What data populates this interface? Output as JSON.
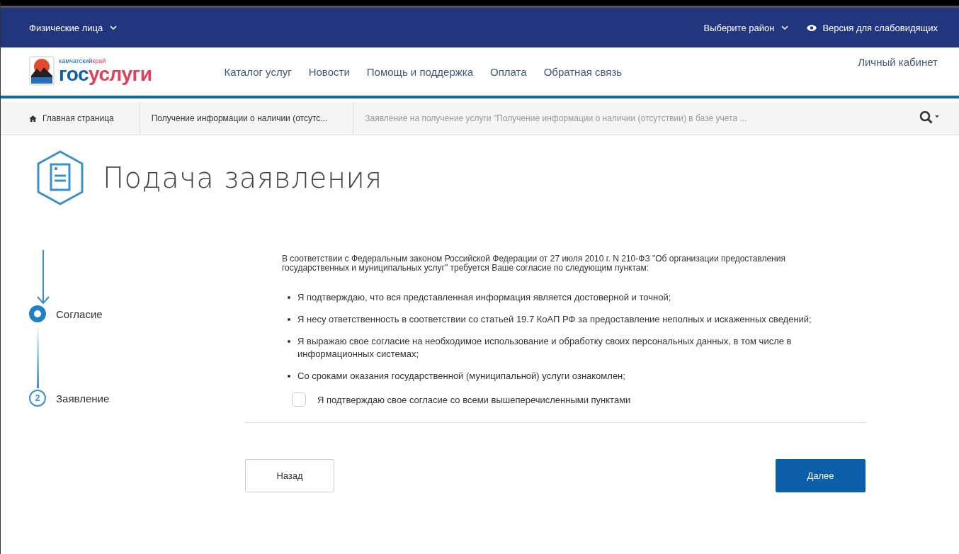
{
  "top_bar": {
    "audience": "Физические лица",
    "region": "Выберите район",
    "accessibility": "Версия для слабовидящих"
  },
  "header": {
    "logo_region": "камчатский",
    "logo_region_accent": "край",
    "logo_name": "гос",
    "logo_name_accent": "услуги",
    "nav": [
      "Каталог услуг",
      "Новости",
      "Помощь и поддержка",
      "Оплата",
      "Обратная связь"
    ],
    "account": "Личный кабинет"
  },
  "breadcrumbs": [
    {
      "label": "Главная страница",
      "kind": "home"
    },
    {
      "label": "Получение информации о наличии (отсутс...",
      "kind": "link"
    },
    {
      "label": "Заявление на получение услуги \"Получение информации о наличии (отсутствии) в базе учета ...",
      "kind": "current"
    }
  ],
  "page_title": "Подача заявления",
  "steps": [
    {
      "label": "Согласие",
      "selected": true
    },
    {
      "label": "Заявление",
      "number": "2",
      "selected": false
    }
  ],
  "intro": "В соответствии с Федеральным законом Российской Федерации от 27 июля 2010 г. N 210-ФЗ \"Об организации предоставления государственных и муниципальных услуг\" требуется Ваше согласие по следующим пунктам:",
  "points": [
    "Я подтверждаю, что вся представленная информация является достоверной и точной;",
    "Я несу ответственность в соответствии со статьей 19.7 КоАП РФ за предоставление неполных и искаженных сведений;",
    "Я выражаю свое согласие на необходимое использование и обработку своих персональных данных, в том числе в информационных системах;",
    "Со сроками оказания государственной (муниципальной) услуги ознакомлен;"
  ],
  "agreement": {
    "label": "Я подтверждаю свое согласие со всеми вышеперечисленными пунктами",
    "checked": false
  },
  "buttons": {
    "back": "Назад",
    "next": "Далее"
  }
}
